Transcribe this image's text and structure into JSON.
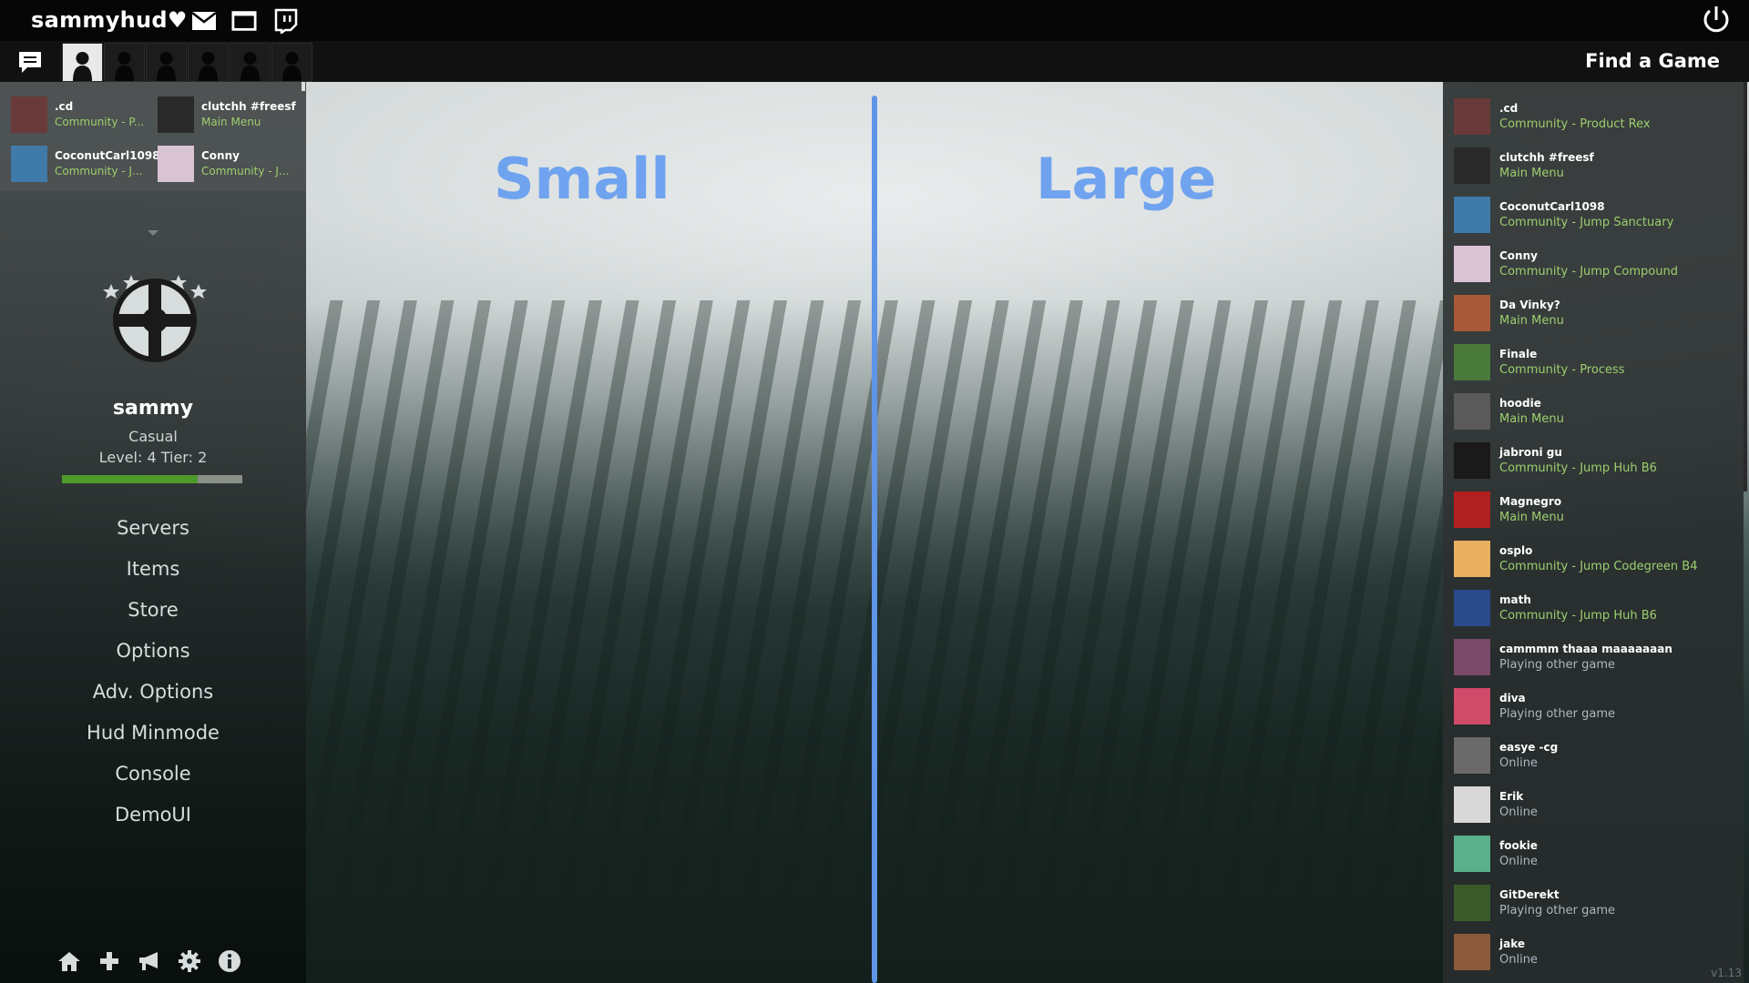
{
  "topbar": {
    "username": "sammyhud♥",
    "icons": [
      "mail-icon",
      "window-icon",
      "twitch-icon"
    ],
    "power_icon": "power-icon"
  },
  "secondbar": {
    "chat_icon": "chat-icon",
    "party_slots": 6,
    "find_game": "Find a Game"
  },
  "mini_friends": [
    {
      "name": ".cd",
      "status": "Community - P...",
      "color": "#6a3a3a"
    },
    {
      "name": "clutchh #freesf",
      "status": "Main Menu",
      "color": "#2a2a2a"
    },
    {
      "name": "CoconutCarl1098",
      "status": "Community - J...",
      "color": "#3f7aa8"
    },
    {
      "name": "Conny",
      "status": "Community - J...",
      "color": "#d9c4d4"
    }
  ],
  "profile": {
    "name": "sammy",
    "rank": "Casual",
    "level": "Level: 4 Tier: 2",
    "xp_fraction": 0.75
  },
  "menu": [
    "Servers",
    "Items",
    "Store",
    "Options",
    "Adv. Options",
    "Hud Minmode",
    "Console",
    "DemoUI"
  ],
  "bottom_icons": [
    "home-icon",
    "plus-icon",
    "megaphone-icon",
    "gear-icon",
    "info-icon"
  ],
  "center": {
    "small_label": "Small",
    "large_label": "Large"
  },
  "friends": [
    {
      "name": ".cd",
      "status": "Community - Product Rex",
      "type": "community",
      "color": "#6a3a3a"
    },
    {
      "name": "clutchh #freesf",
      "status": "Main Menu",
      "type": "menu",
      "color": "#2a2a2a"
    },
    {
      "name": "CoconutCarl1098",
      "status": "Community - Jump Sanctuary",
      "type": "community",
      "color": "#3f7aa8"
    },
    {
      "name": "Conny",
      "status": "Community - Jump Compound",
      "type": "community",
      "color": "#d9c4d4"
    },
    {
      "name": "Da Vinky?",
      "status": "Main Menu",
      "type": "menu",
      "color": "#a8593a"
    },
    {
      "name": "Finale",
      "status": "Community - Process",
      "type": "community",
      "color": "#4a7a3a"
    },
    {
      "name": "hoodie",
      "status": "Main Menu",
      "type": "menu",
      "color": "#5a5a5a"
    },
    {
      "name": "jabroni gu",
      "status": "Community - Jump Huh B6",
      "type": "community",
      "color": "#1a1a1a"
    },
    {
      "name": "Magnegro",
      "status": "Main Menu",
      "type": "menu",
      "color": "#b02020"
    },
    {
      "name": "osplo",
      "status": "Community - Jump Codegreen B4",
      "type": "community",
      "color": "#e8b060"
    },
    {
      "name": "math",
      "status": "Community - Jump Huh B6",
      "type": "community",
      "color": "#2a4a8a"
    },
    {
      "name": "cammmm thaaa maaaaaaan",
      "status": "Playing other game",
      "type": "other",
      "color": "#7a4a6a"
    },
    {
      "name": "diva",
      "status": "Playing other game",
      "type": "other",
      "color": "#d04a6a"
    },
    {
      "name": "easye -cg",
      "status": "Online",
      "type": "online",
      "color": "#6a6a6a"
    },
    {
      "name": "Erik",
      "status": "Online",
      "type": "online",
      "color": "#d8d8d8"
    },
    {
      "name": "fookie",
      "status": "Online",
      "type": "online",
      "color": "#5ab08a"
    },
    {
      "name": "GitDerekt",
      "status": "Playing other game",
      "type": "other",
      "color": "#3a5a2a"
    },
    {
      "name": "jake",
      "status": "Online",
      "type": "online",
      "color": "#8a5a3a"
    }
  ],
  "version": "v1.13"
}
